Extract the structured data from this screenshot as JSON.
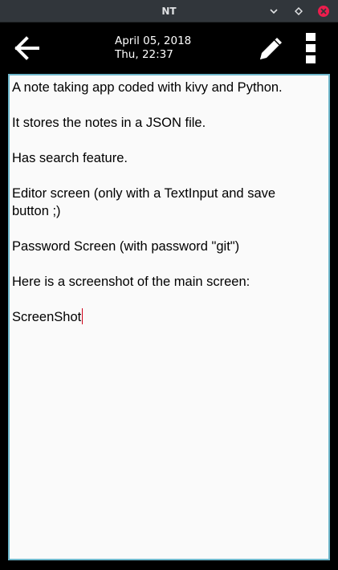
{
  "window": {
    "title": "NT",
    "close_color": "#ed1d4d"
  },
  "toolbar": {
    "back_icon": "arrow-left-icon",
    "date": "April 05, 2018",
    "time": "Thu, 22:37",
    "edit_icon": "pencil-icon",
    "menu_icon": "vertical-dots-icon"
  },
  "editor": {
    "lines": [
      "A note taking app coded with kivy and Python.",
      "It stores the notes in a JSON file.",
      "Has search feature.",
      "Editor screen (only with a TextInput and save",
      "button ;)",
      "Password Screen (with password \"git\")",
      "Here is a screenshot of the main screen:",
      "ScreenShot"
    ],
    "border_color": "#6fb7cb",
    "background": "#fafafa",
    "cursor_color": "#d0021b"
  }
}
